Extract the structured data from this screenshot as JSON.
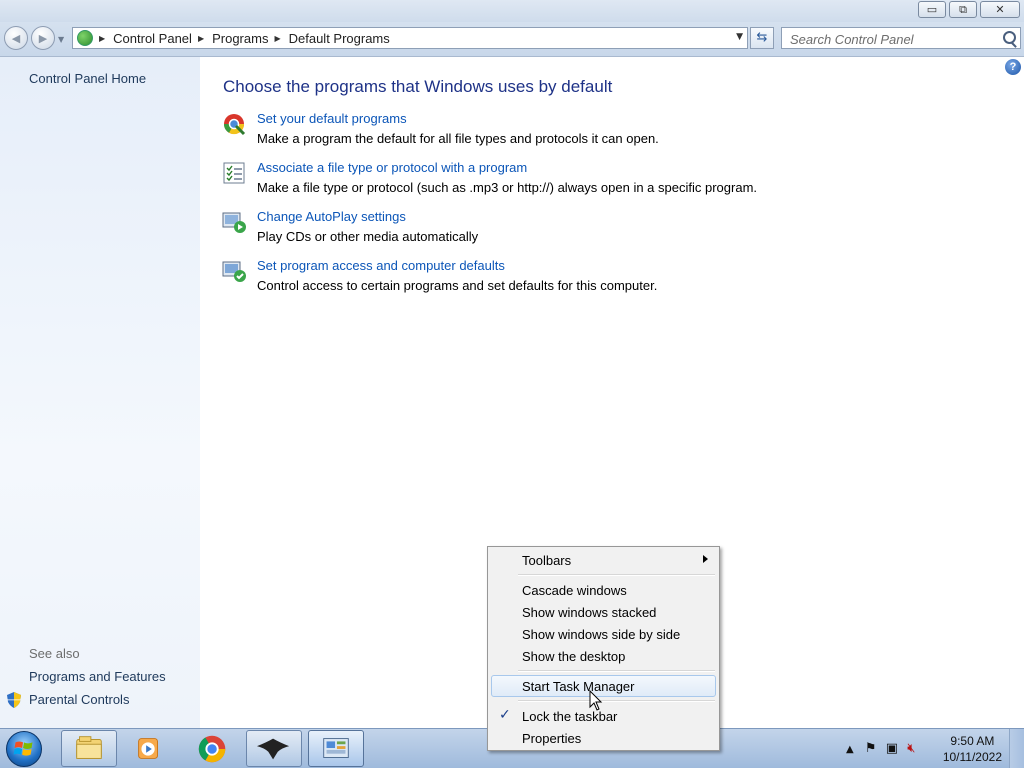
{
  "window": {
    "minimize_glyph": "▭",
    "maximize_glyph": "⧉",
    "close_glyph": "✕"
  },
  "address": {
    "crumbs": [
      "Control Panel",
      "Programs",
      "Default Programs"
    ],
    "search_placeholder": "Search Control Panel"
  },
  "left_pane": {
    "home_link": "Control Panel Home",
    "see_also_label": "See also",
    "see_also_links": [
      "Programs and Features",
      "Parental Controls"
    ]
  },
  "main": {
    "title": "Choose the programs that Windows uses by default",
    "tasks": [
      {
        "icon": "default-programs-icon",
        "link": "Set your default programs",
        "desc": "Make a program the default for all file types and protocols it can open."
      },
      {
        "icon": "file-association-icon",
        "link": "Associate a file type or protocol with a program",
        "desc": "Make a file type or protocol (such as .mp3 or http://) always open in a specific program."
      },
      {
        "icon": "autoplay-icon",
        "link": "Change AutoPlay settings",
        "desc": "Play CDs or other media automatically"
      },
      {
        "icon": "program-access-icon",
        "link": "Set program access and computer defaults",
        "desc": "Control access to certain programs and set defaults for this computer."
      }
    ]
  },
  "context_menu": {
    "items": [
      {
        "label": "Toolbars",
        "submenu": true
      },
      {
        "label": "Cascade windows"
      },
      {
        "label": "Show windows stacked"
      },
      {
        "label": "Show windows side by side"
      },
      {
        "label": "Show the desktop"
      },
      {
        "label": "Start Task Manager",
        "highlighted": true
      },
      {
        "label": "Lock the taskbar",
        "checked": true
      },
      {
        "label": "Properties"
      }
    ]
  },
  "taskbar": {
    "pinned": [
      "explorer-icon",
      "media-player-icon",
      "chrome-icon",
      "inkscape-icon",
      "control-panel-icon"
    ],
    "time": "9:50 AM",
    "date": "10/11/2022"
  },
  "colors": {
    "link": "#0c56b8",
    "title": "#1e3287",
    "accent": "#1f6fc4"
  }
}
